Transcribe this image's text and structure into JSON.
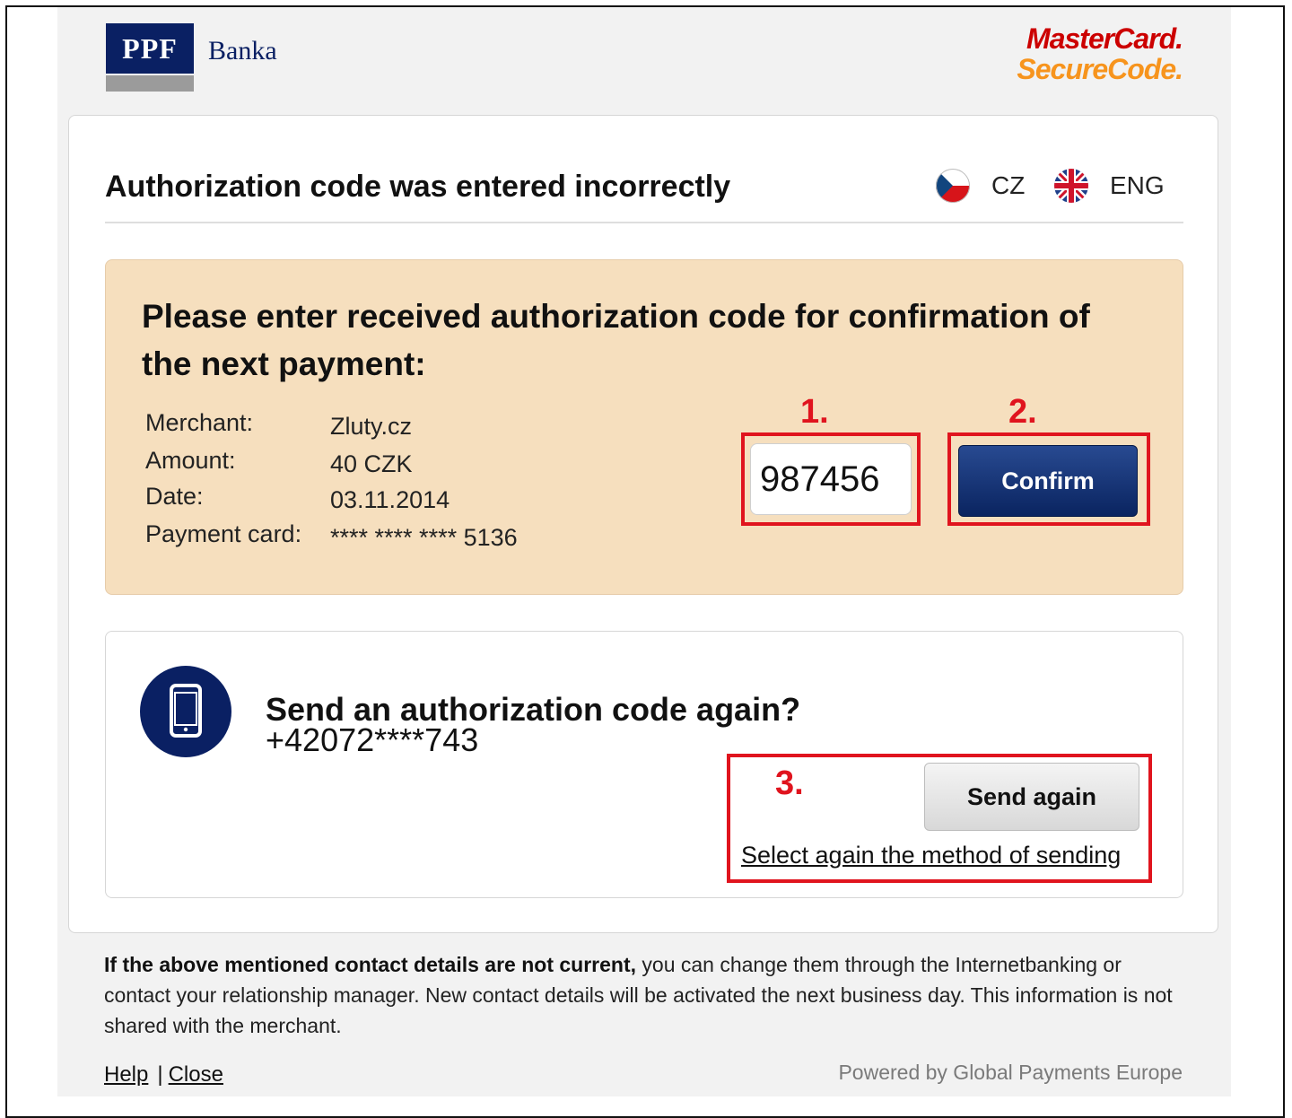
{
  "header": {
    "bank_logo_text": "PPF",
    "bank_name": "Banka",
    "mc_line1": "MasterCard.",
    "mc_line2": "SecureCode."
  },
  "card": {
    "title": "Authorization code was entered incorrectly",
    "languages": [
      {
        "code": "CZ",
        "icon": "czech-flag-icon"
      },
      {
        "code": "ENG",
        "icon": "uk-flag-icon"
      }
    ]
  },
  "payment": {
    "heading": "Please enter received authorization code for confirmation of the next payment:",
    "details": [
      {
        "label": "Merchant:",
        "value": "Zluty.cz"
      },
      {
        "label": "Amount:",
        "value": "40 CZK"
      },
      {
        "label": "Date:",
        "value": "03.11.2014"
      },
      {
        "label": "Payment card:",
        "value": "**** **** **** 5136"
      }
    ],
    "code_value": "987456",
    "confirm_label": "Confirm"
  },
  "annotations": {
    "step1": "1.",
    "step2": "2.",
    "step3": "3.",
    "color": "#e0141e"
  },
  "resend": {
    "title": "Send an authorization code again?",
    "phone": "+42072****743",
    "send_again_label": "Send again",
    "select_method_link": "Select again the method of sending",
    "icon": "mobile-phone-icon"
  },
  "footer": {
    "info_bold": "If the above mentioned contact details are not current,",
    "info_rest": " you can change them through the Internetbanking or contact your relationship manager. New contact details will be activated the next business day. This information is not shared with the merchant.",
    "help_link": "Help",
    "separator": "|",
    "close_link": "Close",
    "powered_by": "Powered by Global Payments Europe"
  },
  "colors": {
    "brand_navy": "#0a2063",
    "payment_box_bg": "#f6dfbe",
    "mc_red": "#cc0000",
    "mc_orange": "#f7941d"
  }
}
